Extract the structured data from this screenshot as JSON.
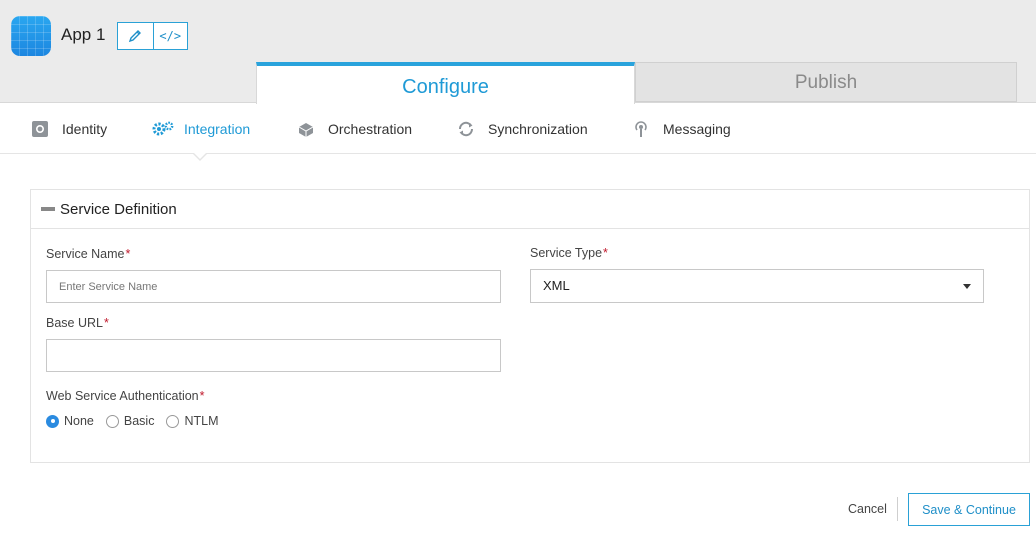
{
  "app": {
    "name": "App 1"
  },
  "header_buttons": [
    {
      "icon": "pencil-icon"
    },
    {
      "icon": "code-icon",
      "glyph": "</>"
    }
  ],
  "main_tabs": [
    {
      "label": "Configure",
      "active": true
    },
    {
      "label": "Publish",
      "active": false
    }
  ],
  "subnav": [
    {
      "label": "Identity",
      "icon": "identity-icon",
      "active": false
    },
    {
      "label": "Integration",
      "icon": "gears-icon",
      "active": true
    },
    {
      "label": "Orchestration",
      "icon": "orchestration-icon",
      "active": false
    },
    {
      "label": "Synchronization",
      "icon": "sync-icon",
      "active": false
    },
    {
      "label": "Messaging",
      "icon": "antenna-icon",
      "active": false
    }
  ],
  "panel": {
    "title": "Service Definition",
    "service_name": {
      "label": "Service Name",
      "required": "*",
      "placeholder": "Enter Service Name",
      "value": ""
    },
    "service_type": {
      "label": "Service Type",
      "required": "*",
      "value": "XML"
    },
    "base_url": {
      "label": "Base URL",
      "required": "*",
      "value": ""
    },
    "auth": {
      "label": "Web Service Authentication",
      "required": "*",
      "options": [
        {
          "label": "None",
          "selected": true
        },
        {
          "label": "Basic",
          "selected": false
        },
        {
          "label": "NTLM",
          "selected": false
        }
      ]
    }
  },
  "actions": {
    "cancel": "Cancel",
    "save": "Save & Continue"
  },
  "colors": {
    "accent": "#1f9ad6",
    "required": "#c0182b",
    "radio_on": "#2b8be0"
  }
}
